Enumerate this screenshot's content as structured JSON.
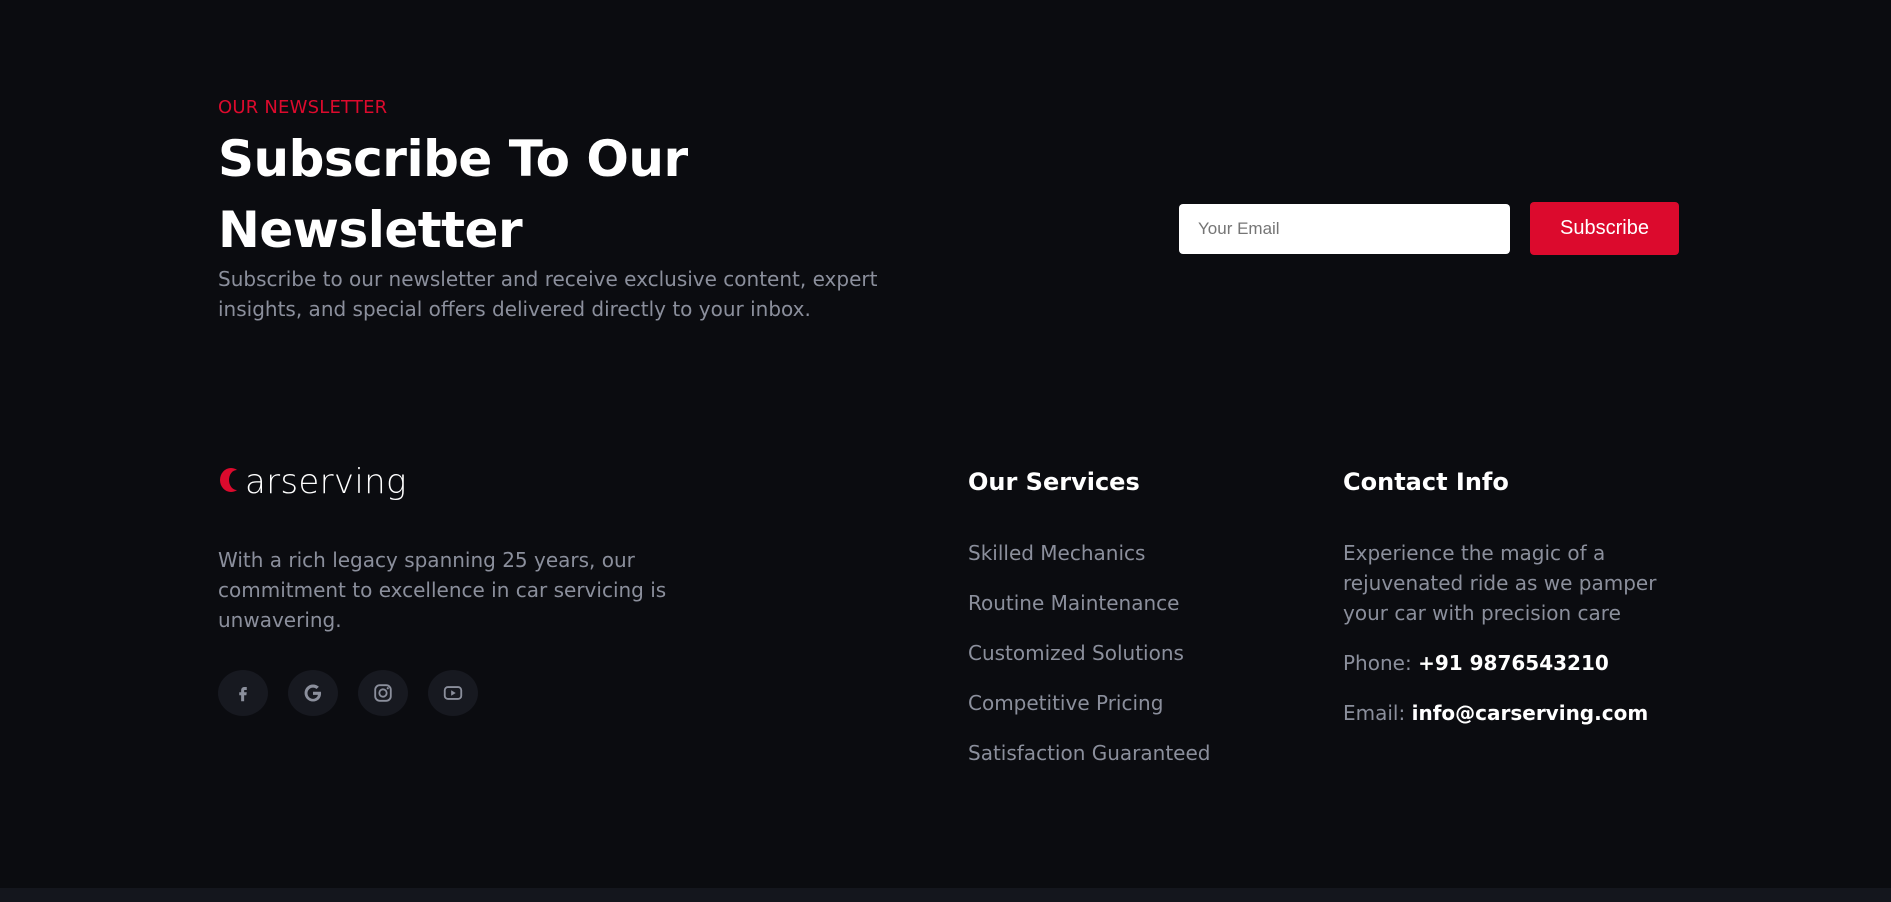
{
  "colors": {
    "background": "#0b0c10",
    "accent": "#dc0a2d",
    "heading": "#ffffff",
    "muted_text": "#8b8f9c",
    "social_bg": "#171920"
  },
  "newsletter": {
    "eyebrow": "OUR NEWSLETTER",
    "title": "Subscribe To Our Newsletter",
    "description": "Subscribe to our newsletter and receive exclusive content, expert insights, and special offers delivered directly to your inbox.",
    "email_placeholder": "Your Email",
    "email_value": "",
    "button_label": "Subscribe"
  },
  "brand": {
    "logo_initial": "C",
    "logo_text": "arserving",
    "description": "With a rich legacy spanning 25 years, our commitment to excellence in car servicing is unwavering.",
    "socials": [
      {
        "name": "facebook",
        "icon": "facebook-icon"
      },
      {
        "name": "google",
        "icon": "google-icon"
      },
      {
        "name": "instagram",
        "icon": "instagram-icon"
      },
      {
        "name": "youtube",
        "icon": "youtube-icon"
      }
    ]
  },
  "services": {
    "title": "Our Services",
    "items": [
      "Skilled Mechanics",
      "Routine Maintenance",
      "Customized Solutions",
      "Competitive Pricing",
      "Satisfaction Guaranteed"
    ]
  },
  "contact": {
    "title": "Contact Info",
    "description": "Experience the magic of a rejuvenated ride as we pamper your car with precision care",
    "phone_label": "Phone:",
    "phone_value": "+91 9876543210",
    "email_label": "Email:",
    "email_value": "info@carserving.com"
  }
}
